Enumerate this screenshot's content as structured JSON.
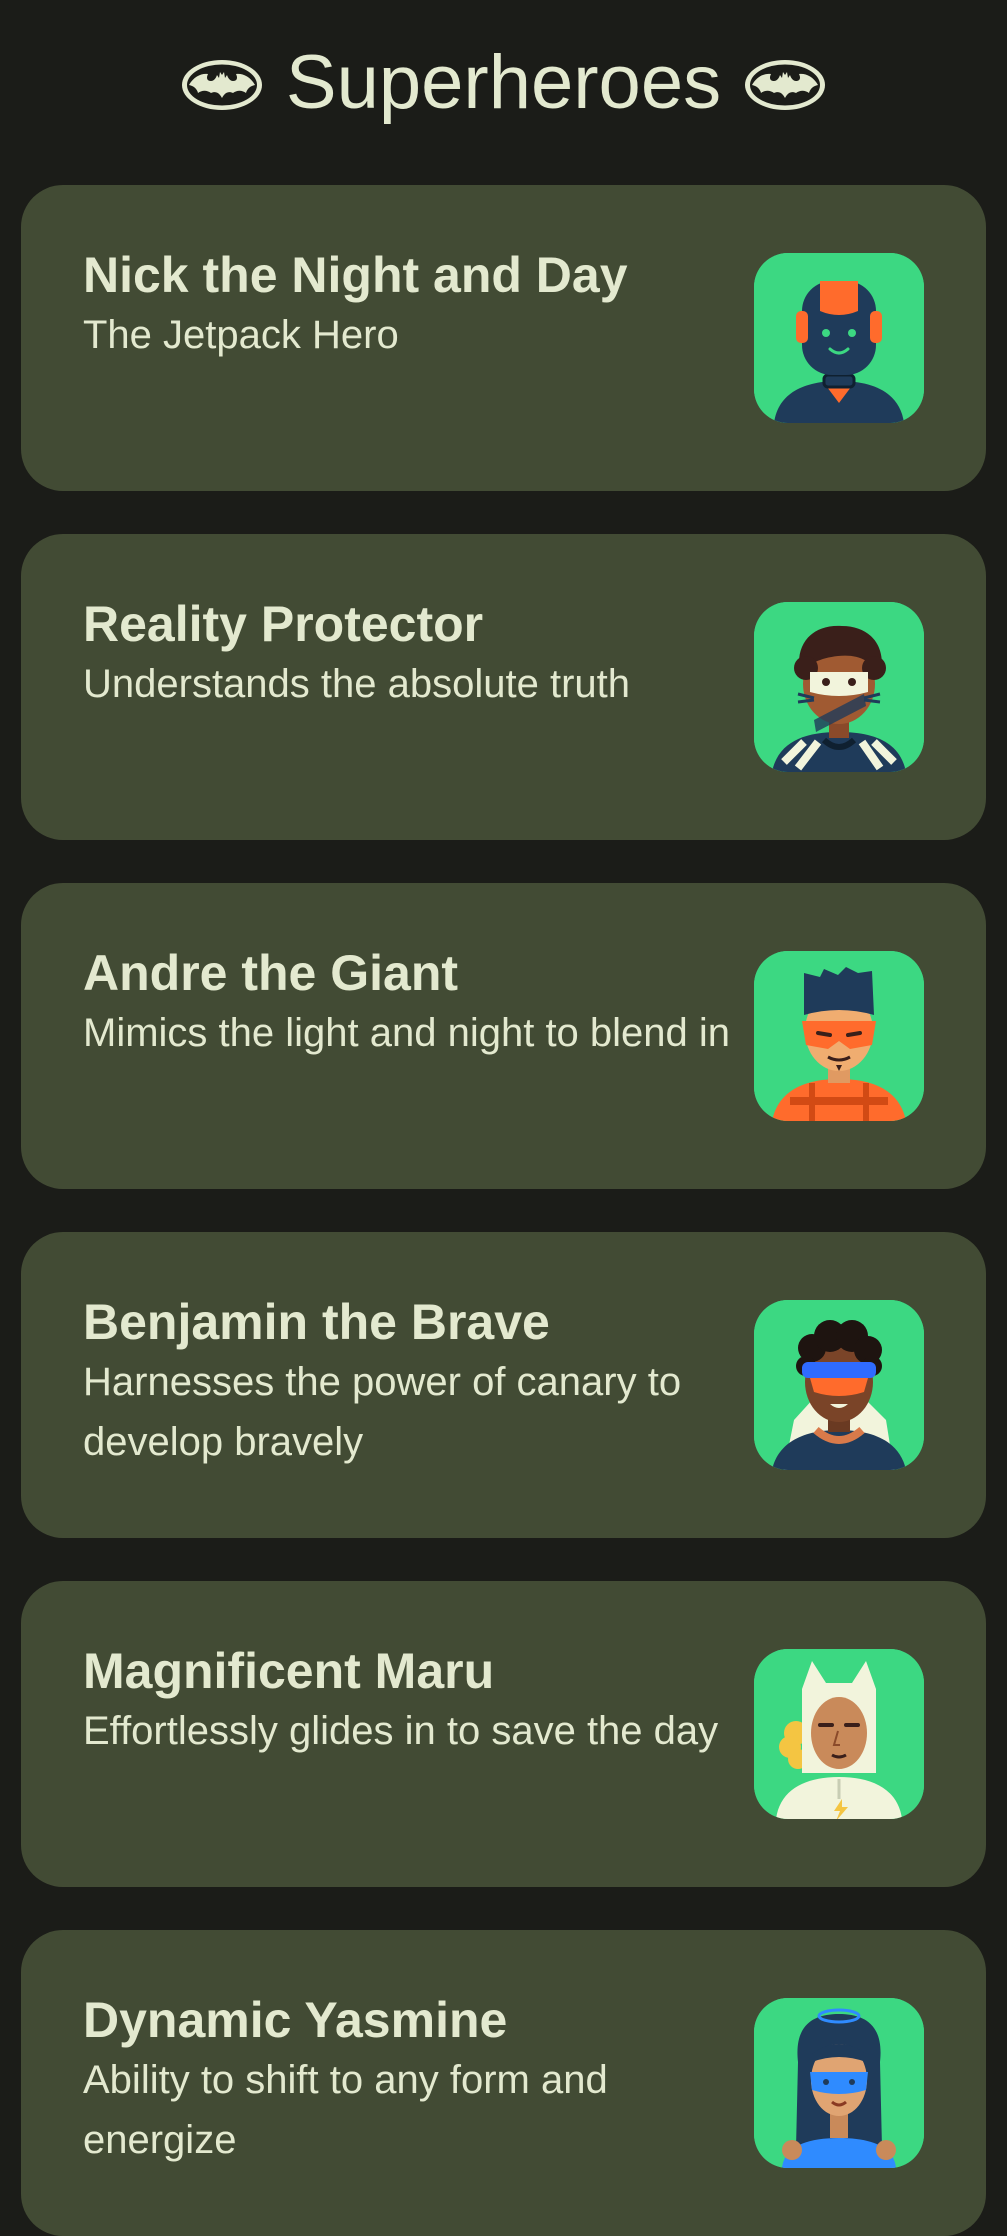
{
  "app": {
    "title": "Superheroes",
    "icon": "bat-icon"
  },
  "colors": {
    "background": "#1b1c18",
    "card": "#424b34",
    "text": "#e3e9cf",
    "avatar_bg": "#3cd882"
  },
  "heroes": [
    {
      "name": "Nick the Night and Day",
      "description": "The Jetpack Hero",
      "avatar": "robot-hero-avatar"
    },
    {
      "name": "Reality Protector",
      "description": "Understands the absolute truth",
      "avatar": "curly-hair-mask-hero-avatar"
    },
    {
      "name": "Andre the Giant",
      "description": "Mimics the light and night to blend in",
      "avatar": "orange-mask-hero-avatar"
    },
    {
      "name": "Benjamin the Brave",
      "description": "Harnesses the power of canary to develop bravely",
      "avatar": "goggles-hero-avatar"
    },
    {
      "name": "Magnificent Maru",
      "description": "Effortlessly glides in to save the day",
      "avatar": "cat-hood-hero-avatar"
    },
    {
      "name": "Dynamic Yasmine",
      "description": "Ability to shift to any form and energize",
      "avatar": "blue-mask-hero-avatar"
    }
  ]
}
